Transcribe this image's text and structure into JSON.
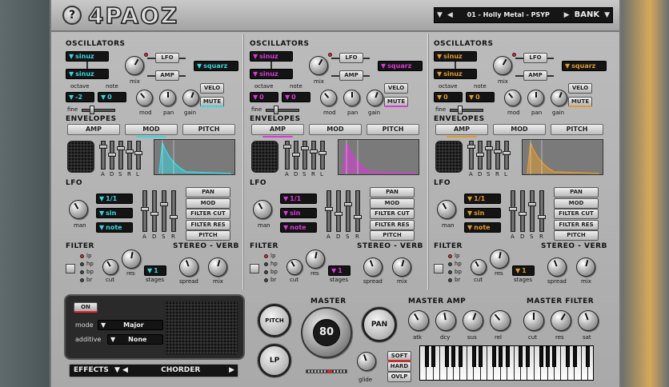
{
  "header": {
    "help_icon": "question-circle-icon",
    "logo": "4PAOZ",
    "preset_name": "01 - Holly Metal - PSYP",
    "bank_label": "BANK"
  },
  "colors": {
    "cyan": "#3bd6e0",
    "magenta": "#d93ad9",
    "orange": "#e09a30"
  },
  "osc_labels": {
    "oscillators": "OSCILLATORS",
    "octave": "octave",
    "note": "note",
    "fine": "fine",
    "mix": "mix",
    "mod": "mod",
    "pan": "pan",
    "gain": "gain",
    "lfo_btn": "LFO",
    "amp_btn": "AMP",
    "velo": "VELO",
    "mute": "MUTE"
  },
  "env_labels": {
    "title": "ENVELOPES",
    "amp": "AMP",
    "mod": "MOD",
    "pitch": "PITCH",
    "a": "A",
    "d": "D",
    "s": "S",
    "r": "R",
    "l": "L"
  },
  "lfo_labels": {
    "title": "LFO",
    "man": "man",
    "a": "A",
    "d": "D",
    "s": "S",
    "r": "R",
    "pan": "PAN",
    "mod": "MOD",
    "cut": "FILTER CUT",
    "res": "FILTER RES",
    "pitch": "PITCH"
  },
  "filter_labels": {
    "title": "FILTER",
    "stereo": "STEREO - VERB",
    "lp": "lp",
    "hp": "hp",
    "bp": "bp",
    "br": "br",
    "cut": "cut",
    "res": "res",
    "stages": "stages",
    "spread": "spread",
    "mix": "mix"
  },
  "modules": [
    {
      "osc1": "sinuz",
      "osc2": "sinuz",
      "osc3": "squarz",
      "octave": "-2",
      "note": "0",
      "lfo_val": "1/1",
      "lfo_wave": "sin",
      "lfo_mode": "note",
      "stages": "1",
      "accent": "#3bd6e0"
    },
    {
      "osc1": "sinuz",
      "osc2": "sinuz",
      "osc3": "squarz",
      "octave": "0",
      "note": "0",
      "lfo_val": "1/1",
      "lfo_wave": "sin",
      "lfo_mode": "note",
      "stages": "1",
      "accent": "#d93ad9"
    },
    {
      "osc1": "sinuz",
      "osc2": "sinuz",
      "osc3": "squarz",
      "octave": "0",
      "note": "0",
      "lfo_val": "1/1",
      "lfo_wave": "sin",
      "lfo_mode": "note",
      "stages": "1",
      "accent": "#e09a30"
    }
  ],
  "bottom": {
    "on": "ON",
    "mode_label": "mode",
    "mode_value": "Major",
    "additive_label": "additive",
    "additive_value": "None",
    "effects_label": "EFFECTS",
    "effects_value": "CHORDER"
  },
  "master": {
    "title": "MASTER",
    "pitch": "PITCH",
    "lp": "LP",
    "pan": "PAN",
    "volume": "80",
    "glide": "glide",
    "soft": "SOFT",
    "hard": "HARD",
    "ovlp": "OVLP"
  },
  "master_amp": {
    "title": "MASTER AMP",
    "atk": "atk",
    "dcy": "dcy",
    "sus": "sus",
    "rel": "rel"
  },
  "master_filter": {
    "title": "MASTER FILTER",
    "cut": "cut",
    "res": "res",
    "sat": "sat"
  }
}
